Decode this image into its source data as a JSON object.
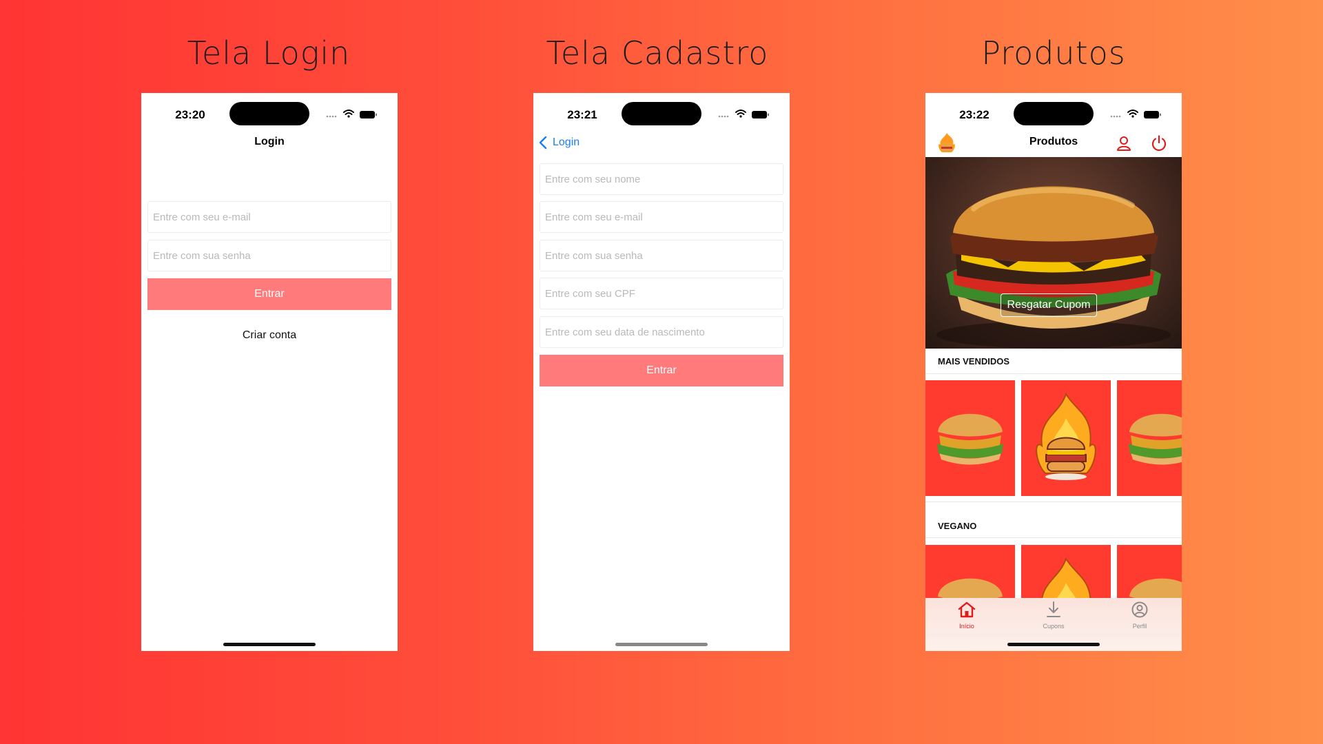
{
  "headings": {
    "login": "Tela Login",
    "cadastro": "Tela Cadastro",
    "produtos": "Produtos"
  },
  "login_screen": {
    "time": "23:20",
    "title": "Login",
    "email_placeholder": "Entre com seu e-mail",
    "password_placeholder": "Entre com sua senha",
    "submit_label": "Entrar",
    "create_account_label": "Criar conta"
  },
  "cadastro_screen": {
    "time": "23:21",
    "back_label": "Login",
    "name_placeholder": "Entre com seu nome",
    "email_placeholder": "Entre com seu e-mail",
    "password_placeholder": "Entre com sua senha",
    "cpf_placeholder": "Entre com seu CPF",
    "birthdate_placeholder": "Entre com seu data de nascimento",
    "submit_label": "Entrar"
  },
  "produtos_screen": {
    "time": "23:22",
    "title": "Produtos",
    "hero_button_label": "Resgatar Cupom",
    "sections": [
      "MAIS VENDIDOS",
      "VEGANO"
    ],
    "tabs": [
      {
        "label": "Início",
        "icon": "home-icon",
        "active": true
      },
      {
        "label": "Cupons",
        "icon": "download-icon",
        "active": false
      },
      {
        "label": "Perfil",
        "icon": "user-circle-icon",
        "active": false
      }
    ]
  },
  "colors": {
    "primary_button": "#ff7a7a",
    "accent_red": "#e01b1b",
    "link_blue": "#1a7cf5",
    "card_red": "#ff3b2f"
  }
}
